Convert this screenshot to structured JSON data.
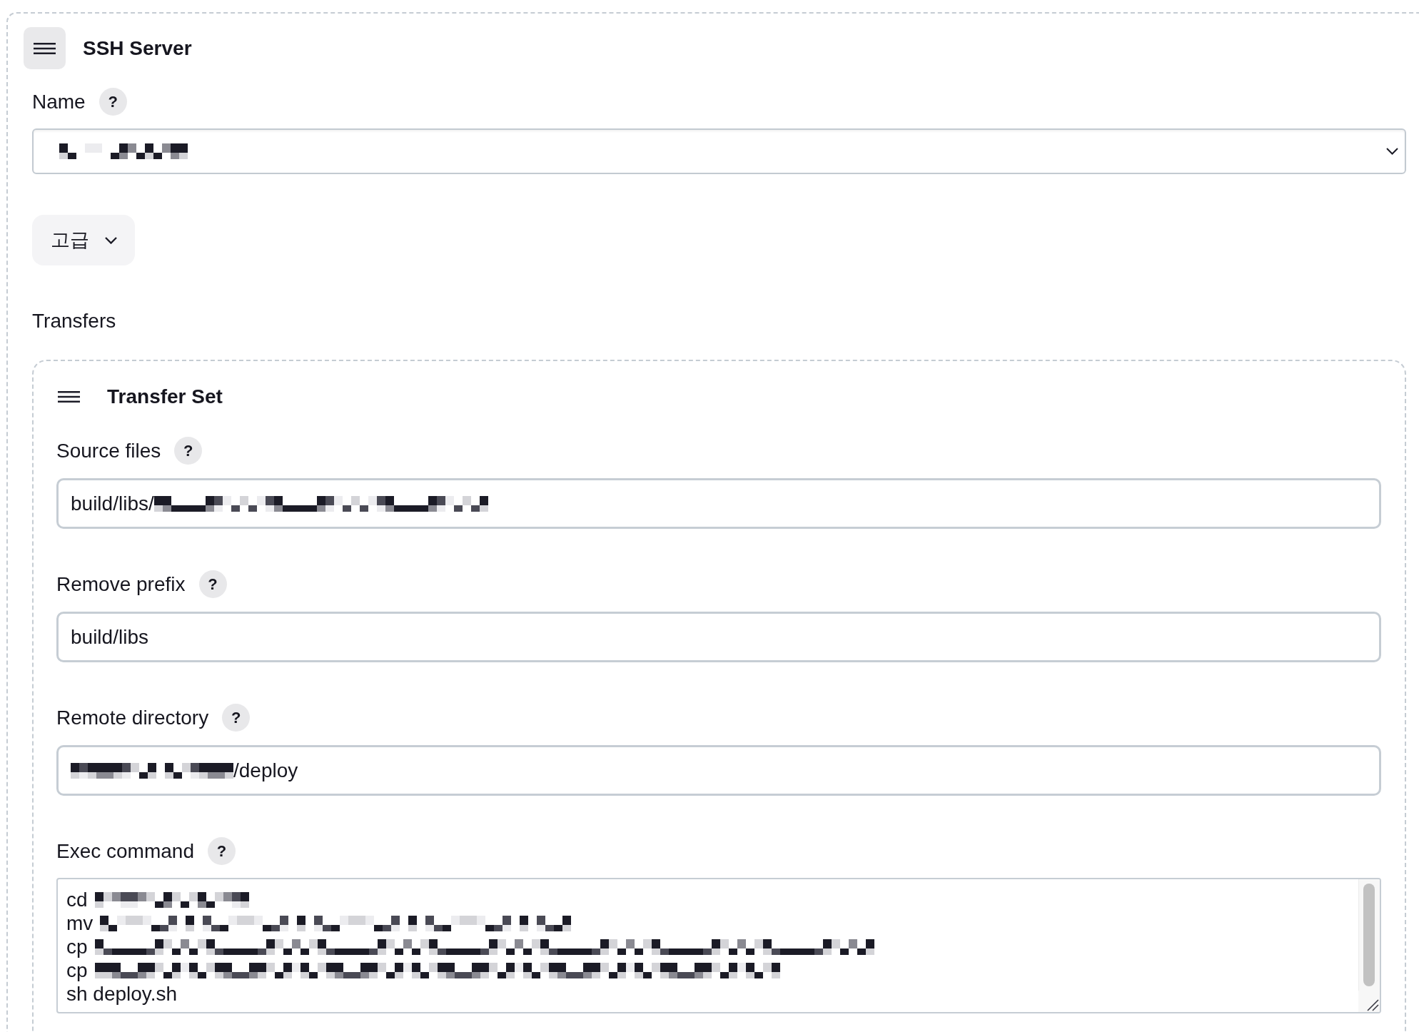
{
  "ssh_server": {
    "title": "SSH Server",
    "name": {
      "label": "Name",
      "help": "?",
      "value": [
        {
          "kind": "redacted"
        }
      ]
    },
    "advanced": {
      "label": "고급",
      "expanded": false
    },
    "transfers_label": "Transfers",
    "transfer_set": {
      "title": "Transfer Set",
      "fields": [
        {
          "kind": "input",
          "label": "Source files",
          "help": "?",
          "value": [
            {
              "kind": "text",
              "text": "build/libs/"
            },
            {
              "kind": "redacted"
            }
          ]
        },
        {
          "kind": "input",
          "label": "Remove prefix",
          "help": "?",
          "value": [
            {
              "kind": "text",
              "text": "build/libs"
            }
          ]
        },
        {
          "kind": "input",
          "label": "Remote directory",
          "help": "?",
          "value": [
            {
              "kind": "redacted"
            },
            {
              "kind": "text",
              "text": "/deploy"
            }
          ]
        },
        {
          "kind": "textarea",
          "label": "Exec command",
          "help": "?",
          "lines": [
            [
              {
                "kind": "text",
                "text": "cd"
              },
              {
                "kind": "redacted"
              }
            ],
            [
              {
                "kind": "text",
                "text": "mv"
              },
              {
                "kind": "redacted"
              }
            ],
            [
              {
                "kind": "text",
                "text": "cp"
              },
              {
                "kind": "redacted"
              }
            ],
            [
              {
                "kind": "text",
                "text": "cp"
              },
              {
                "kind": "redacted"
              }
            ],
            [
              {
                "kind": "text",
                "text": "sh deploy.sh"
              }
            ]
          ]
        }
      ]
    }
  }
}
